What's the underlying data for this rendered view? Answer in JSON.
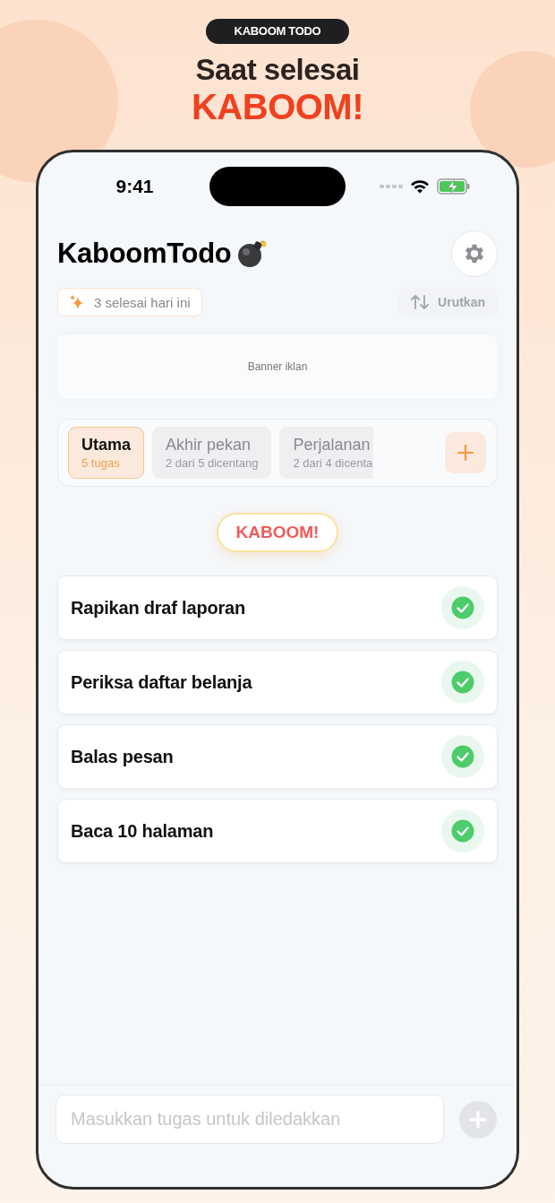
{
  "header": {
    "badge": "KABOOM TODO",
    "headline": "Saat selesai",
    "headline_accent": "KABOOM!"
  },
  "status_bar": {
    "time": "9:41"
  },
  "app": {
    "title": "KaboomTodo"
  },
  "stats_chip": {
    "label": "3 selesai hari ini"
  },
  "sort_button": {
    "label": "Urutkan",
    "disabled": true
  },
  "banner": {
    "label": "Banner iklan"
  },
  "tabs": [
    {
      "name": "Utama",
      "subtitle": "5 tugas",
      "selected": true
    },
    {
      "name": "Akhir pekan",
      "subtitle": "2 dari 5 dicentang",
      "selected": false
    },
    {
      "name": "Perjalanan",
      "subtitle": "2 dari 4 dicenta",
      "selected": false
    }
  ],
  "kaboom_button": {
    "label": "KABOOM!"
  },
  "tasks": [
    {
      "title": "Rapikan draf laporan",
      "done": true
    },
    {
      "title": "Periksa daftar belanja",
      "done": true
    },
    {
      "title": "Balas pesan",
      "done": true
    },
    {
      "title": "Baca 10 halaman",
      "done": true
    }
  ],
  "composer": {
    "placeholder": "Masukkan tugas untuk diledakkan",
    "add_disabled": true
  }
}
